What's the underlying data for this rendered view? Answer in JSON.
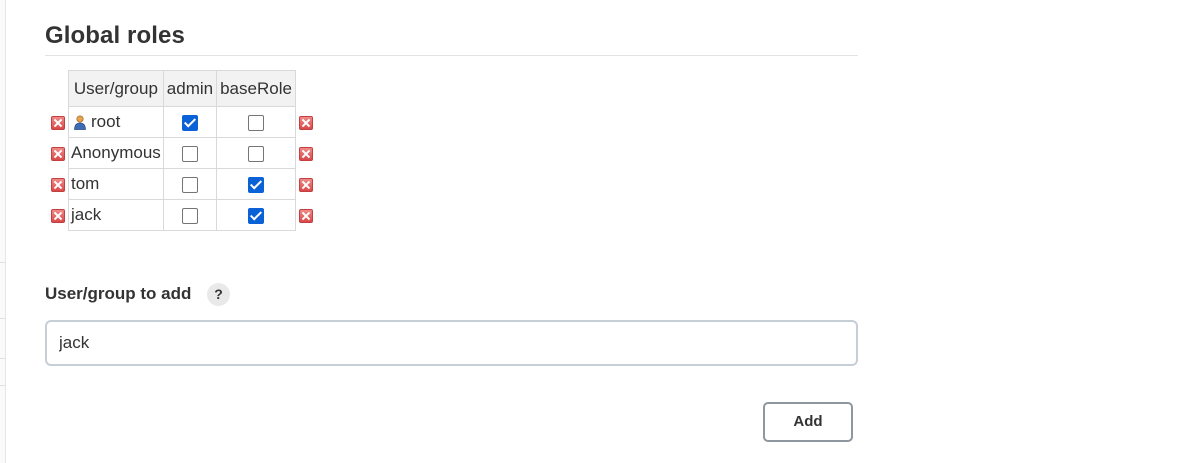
{
  "section": {
    "title": "Global roles"
  },
  "table": {
    "headers": [
      "User/group",
      "admin",
      "baseRole"
    ],
    "rows": [
      {
        "name": "root",
        "icon": "user-icon",
        "admin": true,
        "baseRole": false
      },
      {
        "name": "Anonymous",
        "icon": null,
        "admin": false,
        "baseRole": false
      },
      {
        "name": "tom",
        "icon": null,
        "admin": false,
        "baseRole": true
      },
      {
        "name": "jack",
        "icon": null,
        "admin": false,
        "baseRole": true
      }
    ]
  },
  "add_form": {
    "label": "User/group to add",
    "help": "?",
    "input_value": "jack",
    "button_label": "Add"
  },
  "colors": {
    "checkbox_checked": "#0b62d6",
    "delete_icon": "#d94848"
  }
}
